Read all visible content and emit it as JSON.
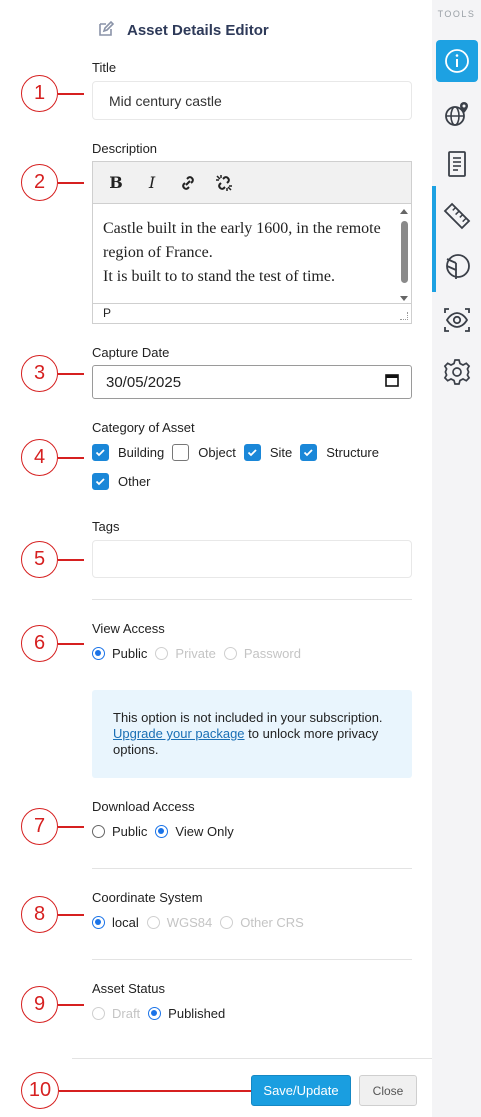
{
  "header": {
    "title": "Asset Details Editor",
    "icon": "edit-icon"
  },
  "tools": {
    "label": "TOOLS",
    "items": [
      {
        "icon": "info-icon",
        "active": true
      },
      {
        "icon": "globe-pin-icon"
      },
      {
        "icon": "document-icon"
      },
      {
        "icon": "ruler-icon"
      },
      {
        "icon": "area-measure-icon"
      },
      {
        "icon": "eye-scan-icon"
      },
      {
        "icon": "settings-icon"
      }
    ],
    "accent_color": "#1da1e2"
  },
  "callouts": [
    "1",
    "2",
    "3",
    "4",
    "5",
    "6",
    "7",
    "8",
    "9",
    "10"
  ],
  "title_field": {
    "label": "Title",
    "value": "Mid century castle"
  },
  "description": {
    "label": "Description",
    "toolbar": {
      "bold": "B",
      "italic": "I"
    },
    "lines": [
      "Castle built in the early 1600, in the remote",
      "region of France.",
      "It is built to to stand the test of time."
    ],
    "status": "P"
  },
  "capture_date": {
    "label": "Capture Date",
    "value": "30/05/2025"
  },
  "category": {
    "label": "Category of Asset",
    "options": [
      {
        "label": "Building",
        "checked": true
      },
      {
        "label": "Object",
        "checked": false
      },
      {
        "label": "Site",
        "checked": true
      },
      {
        "label": "Structure",
        "checked": true
      },
      {
        "label": "Other",
        "checked": true
      }
    ]
  },
  "tags": {
    "label": "Tags",
    "value": ""
  },
  "view_access": {
    "label": "View Access",
    "options": [
      {
        "label": "Public",
        "checked": true,
        "disabled": false
      },
      {
        "label": "Private",
        "checked": false,
        "disabled": true
      },
      {
        "label": "Password",
        "checked": false,
        "disabled": true
      }
    ],
    "notice_part1": "This option is not included in your subscription.",
    "notice_link": "Upgrade your package",
    "notice_part2": "to unlock more privacy options."
  },
  "download_access": {
    "label": "Download Access",
    "options": [
      {
        "label": "Public",
        "checked": false
      },
      {
        "label": "View Only",
        "checked": true
      }
    ]
  },
  "coordinate_system": {
    "label": "Coordinate System",
    "options": [
      {
        "label": "local",
        "checked": true,
        "disabled": false
      },
      {
        "label": "WGS84",
        "checked": false,
        "disabled": true
      },
      {
        "label": "Other CRS",
        "checked": false,
        "disabled": true
      }
    ]
  },
  "asset_status": {
    "label": "Asset Status",
    "options": [
      {
        "label": "Draft",
        "checked": false,
        "disabled": true
      },
      {
        "label": "Published",
        "checked": true,
        "disabled": false
      }
    ]
  },
  "buttons": {
    "save": "Save/Update",
    "close": "Close"
  }
}
